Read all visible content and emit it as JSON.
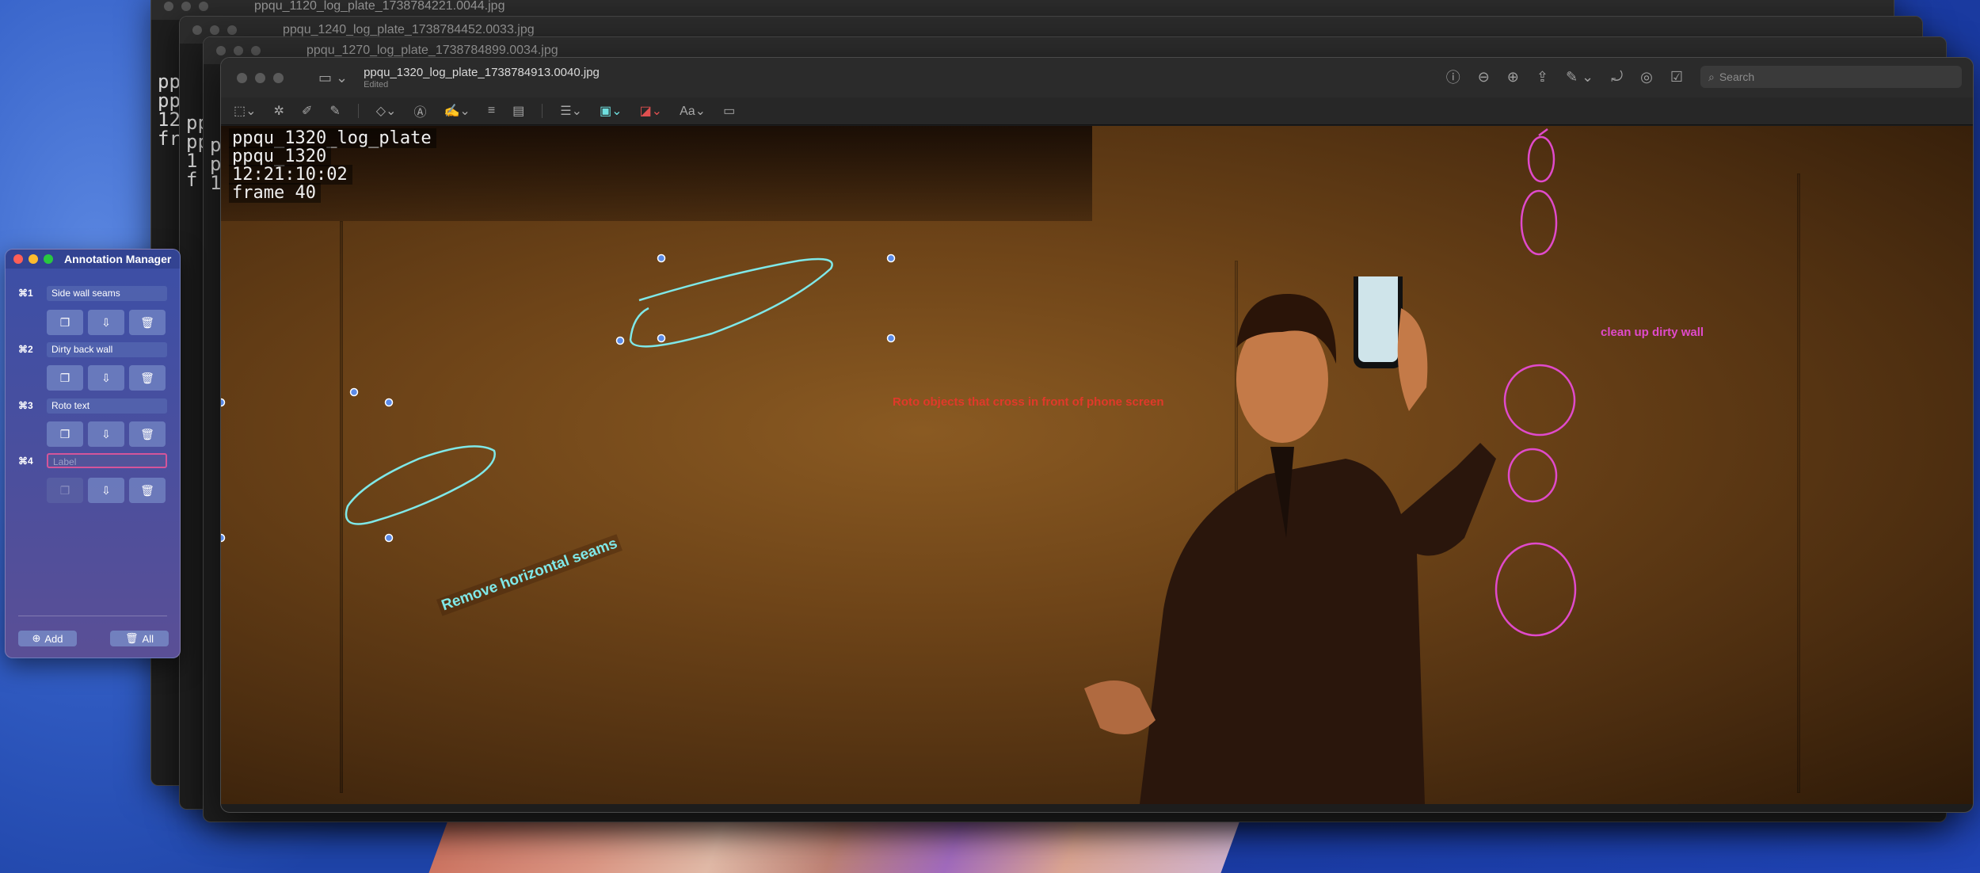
{
  "windows_bg": [
    {
      "filename": "ppqu_1120_log_plate_1738784221.0044.jpg"
    },
    {
      "filename": "ppqu_1240_log_plate_1738784452.0033.jpg"
    },
    {
      "filename": "ppqu_1270_log_plate_1738784899.0034.jpg"
    }
  ],
  "bg_terminal": {
    "a": [
      "pp",
      "pp",
      "12",
      "fr"
    ],
    "b": [
      "pp",
      "pp",
      "1",
      "f"
    ],
    "c": [
      "p",
      "p",
      "1"
    ]
  },
  "main_window": {
    "title": "ppqu_1320_log_plate_1738784913.0040.jpg",
    "subtitle": "Edited",
    "search_placeholder": "Search",
    "markup_tool_aa": "Aa"
  },
  "slate": {
    "line1": "ppqu_1320_log_plate",
    "line2": "ppqu_1320",
    "line3": "12:21:10:02",
    "line4": "frame 40"
  },
  "annotations": {
    "red": "Roto objects that cross in front of phone screen",
    "pink": "clean up dirty wall",
    "cyan": "Remove horizontal seams"
  },
  "annotation_manager": {
    "title": "Annotation Manager",
    "entries": [
      {
        "key": "⌘1",
        "label": "Side wall seams"
      },
      {
        "key": "⌘2",
        "label": "Dirty back wall"
      },
      {
        "key": "⌘3",
        "label": "Roto text"
      },
      {
        "key": "⌘4",
        "label": "",
        "placeholder": "Label"
      }
    ],
    "add_label": "Add",
    "all_label": "All"
  },
  "colors": {
    "annot_red": "#e0392a",
    "annot_pink": "#e04acb",
    "annot_cyan": "#7fe8e8"
  }
}
